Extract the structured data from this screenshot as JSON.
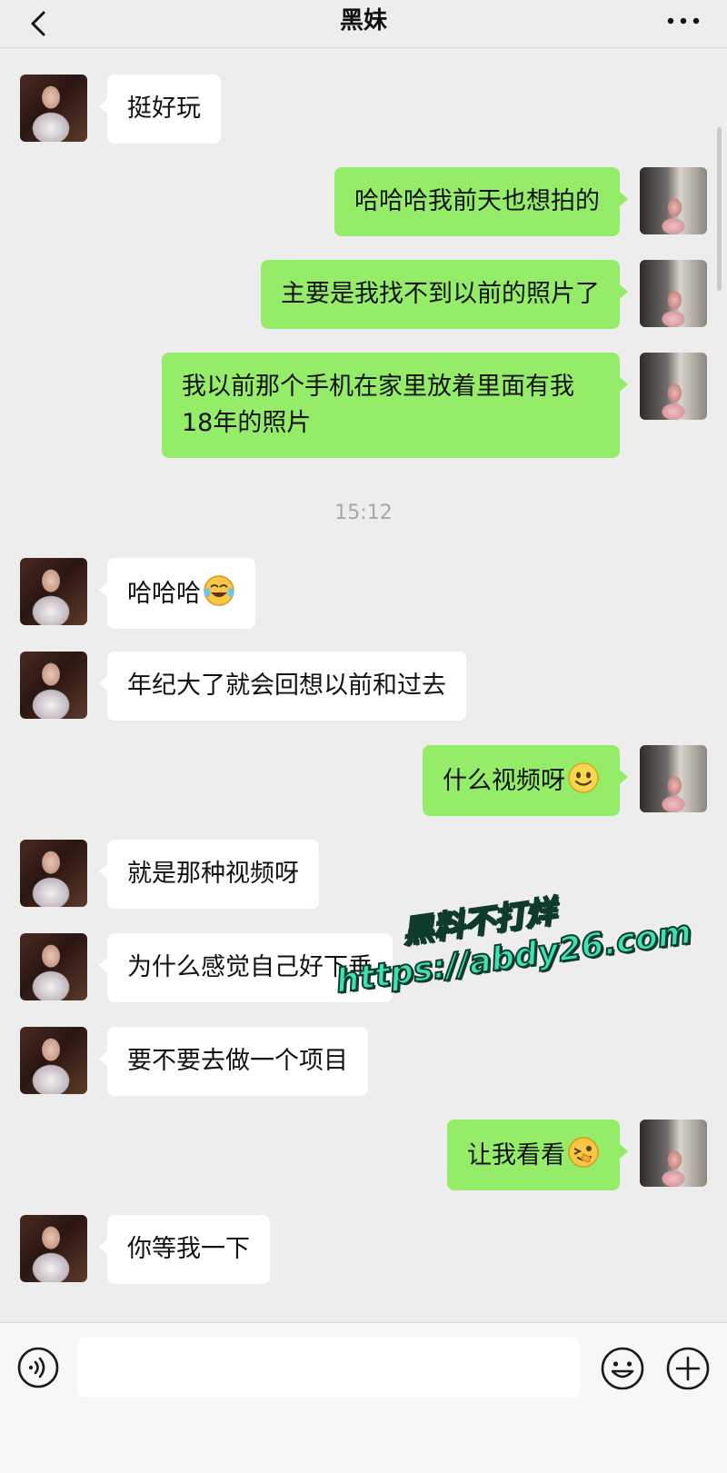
{
  "header": {
    "title": "黑妹",
    "back_icon": "chevron-left-icon",
    "more_icon": "more-dots-icon"
  },
  "colors": {
    "background": "#ededed",
    "bubble_incoming": "#ffffff",
    "bubble_outgoing": "#95ec69",
    "timestamp_text": "#a7a7a7"
  },
  "messages": [
    {
      "side": "left",
      "text": "挺好玩"
    },
    {
      "side": "right",
      "text": "哈哈哈我前天也想拍的"
    },
    {
      "side": "right",
      "text": "主要是我找不到以前的照片了"
    },
    {
      "side": "right",
      "text": "我以前那个手机在家里放着里面有我18年的照片"
    },
    {
      "side": "left",
      "text": "哈哈哈",
      "emoji": "tears-of-joy-emoji"
    },
    {
      "side": "left",
      "text": "年纪大了就会回想以前和过去"
    },
    {
      "side": "right",
      "text": "什么视频呀",
      "emoji": "smile-emoji"
    },
    {
      "side": "left",
      "text": "就是那种视频呀"
    },
    {
      "side": "left",
      "text": "为什么感觉自己好下垂"
    },
    {
      "side": "left",
      "text": "要不要去做一个项目"
    },
    {
      "side": "right",
      "text": "让我看看",
      "emoji": "wink-emoji"
    },
    {
      "side": "left",
      "text": "你等我一下"
    }
  ],
  "timestamp": "15:12",
  "watermark": {
    "line1": "黑料不打烊",
    "line2": "https://abdy26.com"
  },
  "input": {
    "placeholder": "",
    "voice_icon": "voice-icon",
    "emoji_icon": "emoji-icon",
    "plus_icon": "plus-icon"
  }
}
